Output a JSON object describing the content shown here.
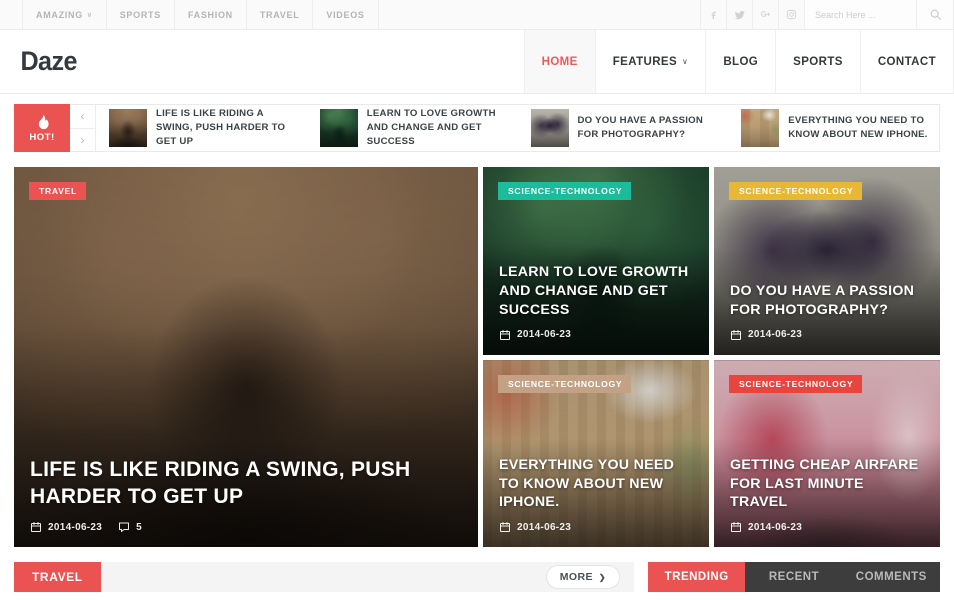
{
  "topbar": {
    "nav": [
      {
        "label": "AMAZING",
        "caret": true
      },
      {
        "label": "SPORTS",
        "caret": false
      },
      {
        "label": "FASHION",
        "caret": false
      },
      {
        "label": "TRAVEL",
        "caret": false
      },
      {
        "label": "VIDEOS",
        "caret": false
      }
    ],
    "social": [
      "facebook-icon",
      "twitter-icon",
      "googleplus-icon",
      "instagram-icon"
    ],
    "search_placeholder": "Search Here ...",
    "search_value": ""
  },
  "header": {
    "logo": "Daze",
    "nav": [
      {
        "label": "HOME",
        "active": true,
        "caret": false
      },
      {
        "label": "FEATURES",
        "active": false,
        "caret": true
      },
      {
        "label": "BLOG",
        "active": false,
        "caret": false
      },
      {
        "label": "SPORTS",
        "active": false,
        "caret": false
      },
      {
        "label": "CONTACT",
        "active": false,
        "caret": false
      }
    ]
  },
  "ticker": {
    "badge_label": "HOT!",
    "prev_label": "‹",
    "next_label": "›",
    "items": [
      {
        "title": "LIFE IS LIKE RIDING A SWING, PUSH HARDER TO GET UP"
      },
      {
        "title": "LEARN TO LOVE GROWTH AND CHANGE AND GET SUCCESS"
      },
      {
        "title": "DO YOU HAVE A PASSION FOR PHOTOGRAPHY?"
      },
      {
        "title": "EVERYTHING YOU NEED TO KNOW ABOUT NEW IPHONE."
      }
    ]
  },
  "featured": {
    "main": {
      "category": "TRAVEL",
      "category_color": "#ea5351",
      "title": "LIFE IS LIKE RIDING A SWING, PUSH HARDER TO GET UP",
      "date": "2014-06-23",
      "comments": "5"
    },
    "cards": [
      {
        "category": "SCIENCE-TECHNOLOGY",
        "category_color": "#1abc9c",
        "title": "LEARN TO LOVE GROWTH AND CHANGE AND GET SUCCESS",
        "date": "2014-06-23"
      },
      {
        "category": "SCIENCE-TECHNOLOGY",
        "category_color": "#e8b733",
        "title": "DO YOU HAVE A PASSION FOR PHOTOGRAPHY?",
        "date": "2014-06-23"
      },
      {
        "category": "SCIENCE-TECHNOLOGY",
        "category_color": "#c2a184",
        "title": "EVERYTHING YOU NEED TO KNOW ABOUT NEW IPHONE.",
        "date": "2014-06-23"
      },
      {
        "category": "SCIENCE-TECHNOLOGY",
        "category_color": "#e8453f",
        "title": "GETTING CHEAP AIRFARE FOR LAST MINUTE TRAVEL",
        "date": "2014-06-23"
      }
    ]
  },
  "bottom": {
    "section_title": "TRAVEL",
    "more_label": "MORE",
    "more_caret": "❯",
    "tabs": [
      {
        "label": "TRENDING",
        "active": true
      },
      {
        "label": "RECENT",
        "active": false
      },
      {
        "label": "COMMENTS",
        "active": false
      }
    ]
  },
  "colors": {
    "accent": "#ea5351",
    "dark": "#3d3d3d",
    "text": "#34393d"
  }
}
